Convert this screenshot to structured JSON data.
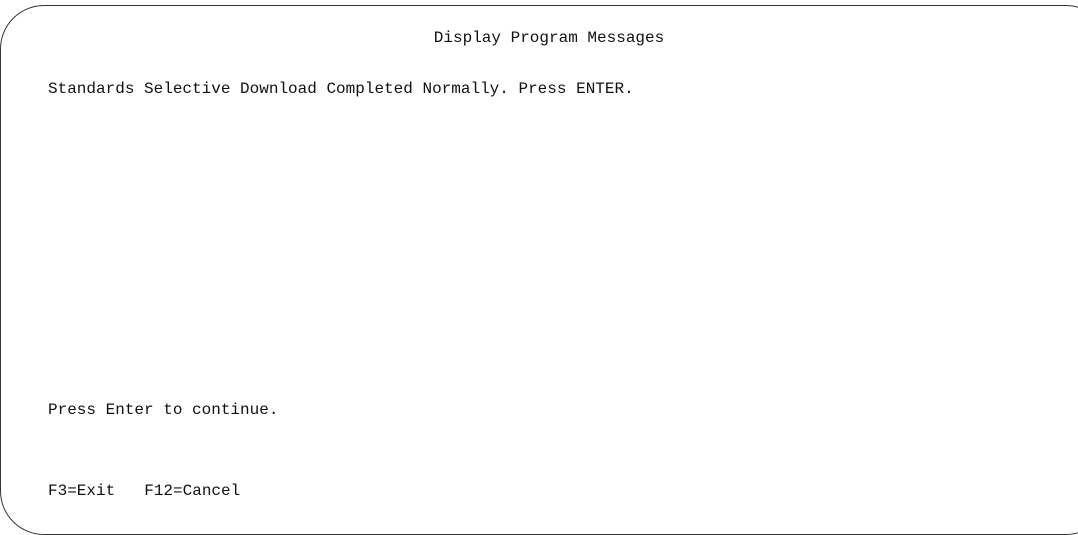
{
  "screen": {
    "title": "Display Program Messages",
    "message": "Standards Selective Download Completed Normally. Press ENTER.",
    "prompt": "Press Enter to continue.",
    "function_keys": [
      {
        "label": "F3=Exit"
      },
      {
        "label": "F12=Cancel"
      }
    ]
  },
  "colors": {
    "background": "#ffffff",
    "text": "#111111",
    "frame": "#333333"
  }
}
